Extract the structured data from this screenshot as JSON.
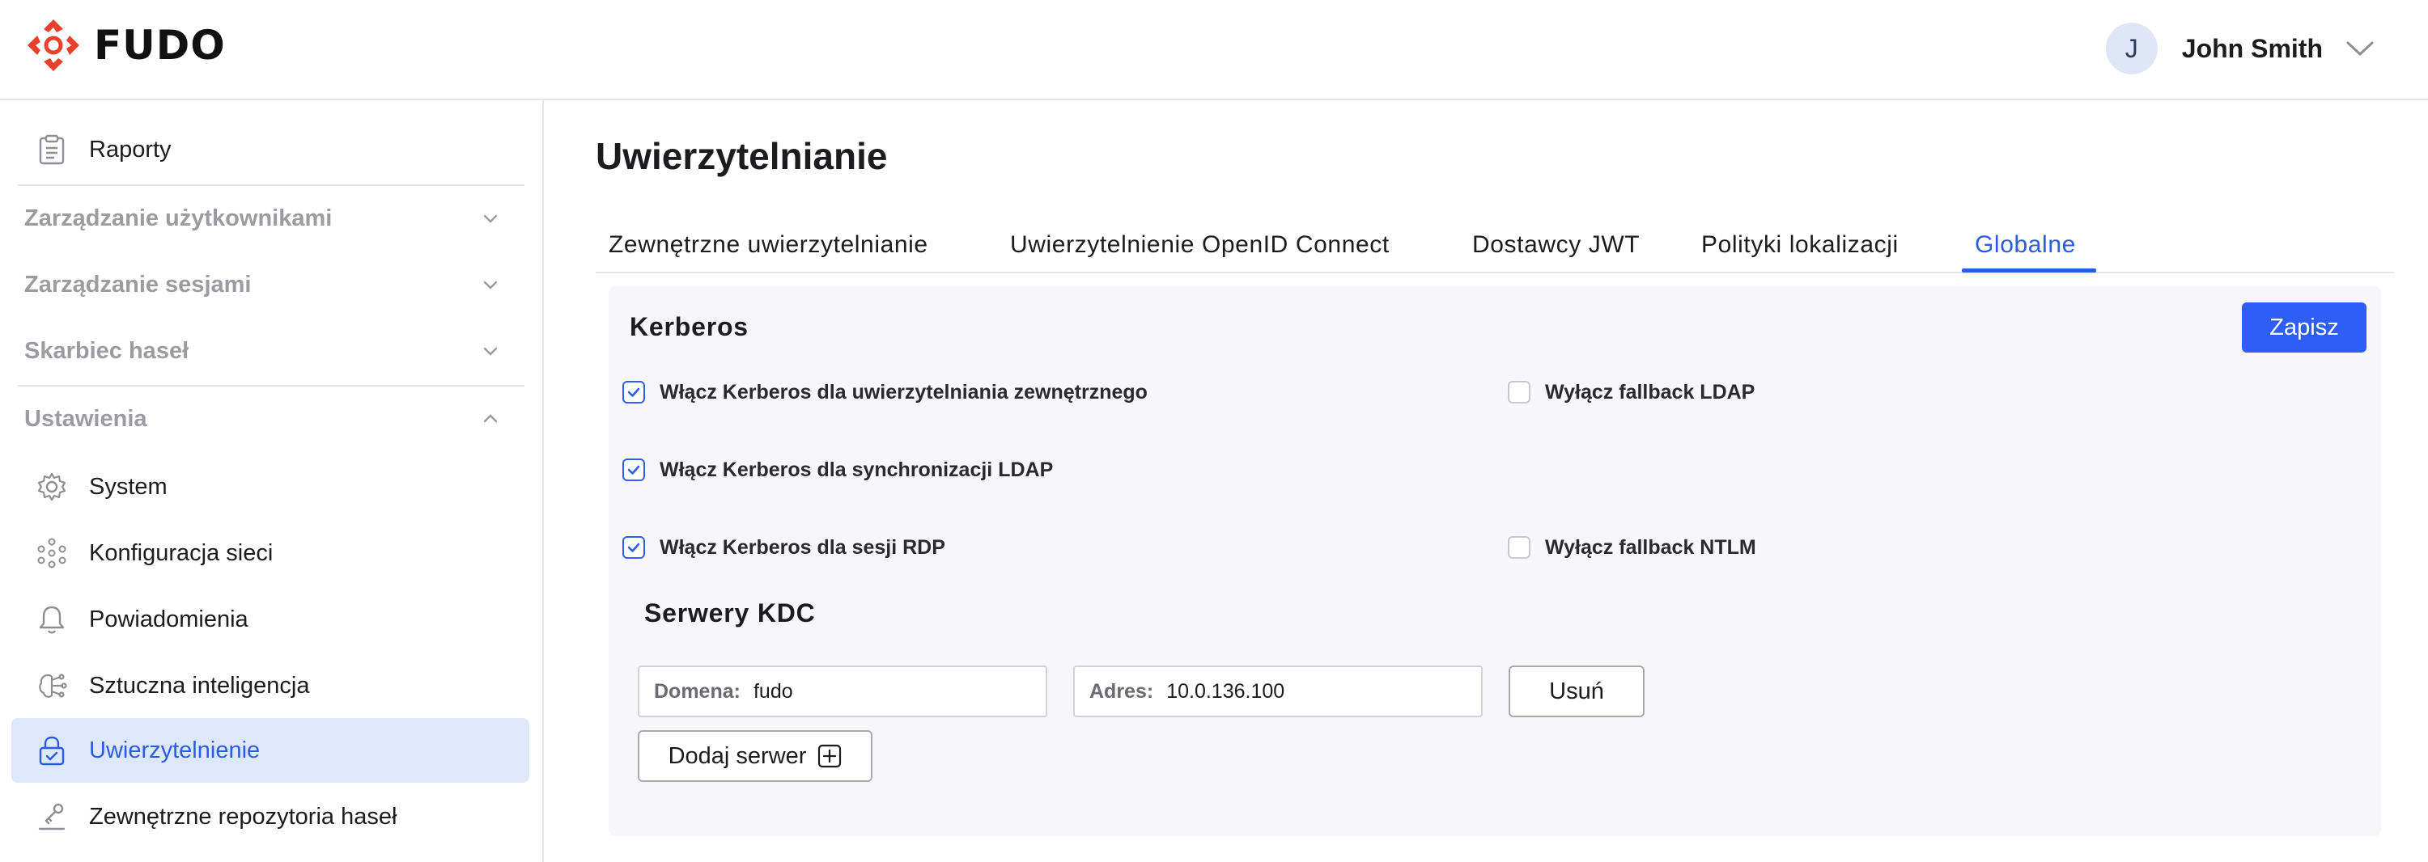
{
  "app": {
    "logo_text": "FUDO",
    "brand_color": "#e8412c",
    "accent_color": "#2f5ef7"
  },
  "user": {
    "initial": "J",
    "name": "John Smith"
  },
  "sidebar": {
    "items": [
      {
        "label": "Raporty",
        "icon": "clipboard-icon"
      },
      {
        "label": "Zarządzanie użytkownikami",
        "group": true,
        "expanded": false
      },
      {
        "label": "Zarządzanie sesjami",
        "group": true,
        "expanded": false
      },
      {
        "label": "Skarbiec haseł",
        "group": true,
        "expanded": false
      },
      {
        "label": "Ustawienia",
        "group": true,
        "expanded": true
      },
      {
        "label": "System",
        "icon": "gear-icon"
      },
      {
        "label": "Konfiguracja sieci",
        "icon": "network-icon"
      },
      {
        "label": "Powiadomienia",
        "icon": "bell-icon"
      },
      {
        "label": "Sztuczna inteligencja",
        "icon": "ai-icon"
      },
      {
        "label": "Uwierzytelnienie",
        "icon": "lock-icon",
        "active": true
      },
      {
        "label": "Zewnętrzne repozytoria haseł",
        "icon": "key-icon"
      }
    ]
  },
  "main": {
    "title": "Uwierzytelnianie",
    "tabs": [
      {
        "label": "Zewnętrzne uwierzytelnianie"
      },
      {
        "label": "Uwierzytelnienie OpenID Connect"
      },
      {
        "label": "Dostawcy JWT"
      },
      {
        "label": "Polityki lokalizacji"
      },
      {
        "label": "Globalne",
        "active": true
      }
    ],
    "kerberos": {
      "title": "Kerberos",
      "save_label": "Zapisz",
      "options": [
        {
          "label": "Włącz Kerberos dla uwierzytelniania zewnętrznego",
          "checked": true
        },
        {
          "label": "Wyłącz fallback LDAP",
          "checked": false
        },
        {
          "label": "Włącz Kerberos dla synchronizacji LDAP",
          "checked": true
        },
        {
          "label": "Włącz Kerberos dla sesji RDP",
          "checked": true
        },
        {
          "label": "Wyłącz fallback NTLM",
          "checked": false
        }
      ]
    },
    "kdc": {
      "title": "Serwery KDC",
      "domain_label": "Domena:",
      "domain_value": "fudo",
      "address_label": "Adres:",
      "address_value": "10.0.136.100",
      "remove_label": "Usuń",
      "add_label": "Dodaj serwer"
    }
  }
}
